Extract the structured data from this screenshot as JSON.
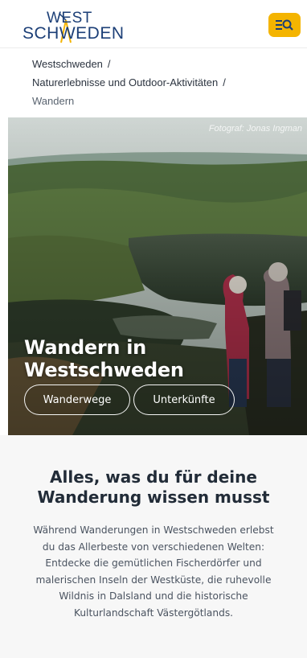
{
  "header": {
    "logo_top": "WEST",
    "logo_bottom": "SCHWEDEN",
    "menu_icon": "menu-search-icon",
    "accent_color": "#f4b400",
    "brand_color": "#1c3f77"
  },
  "breadcrumb": {
    "items": [
      "Westschweden",
      "Naturerlebnisse und Outdoor-Aktivitäten",
      "Wandern"
    ],
    "separator": "/"
  },
  "hero": {
    "photo_credit": "Fotograf: Jonas Ingman",
    "title": "Wandern in Westschweden",
    "buttons": [
      "Wanderwege",
      "Unterkünfte"
    ]
  },
  "intro": {
    "heading": "Alles, was du für deine Wanderung wissen musst",
    "body": "Während Wanderungen in Westschweden erlebst du das Allerbeste von verschiedenen Welten: Entdecke die gemütlichen Fischerdörfer und malerischen Inseln der Westküste, die ruhevolle Wildnis in Dalsland und die historische Kulturlandschaft Västergötlands."
  }
}
